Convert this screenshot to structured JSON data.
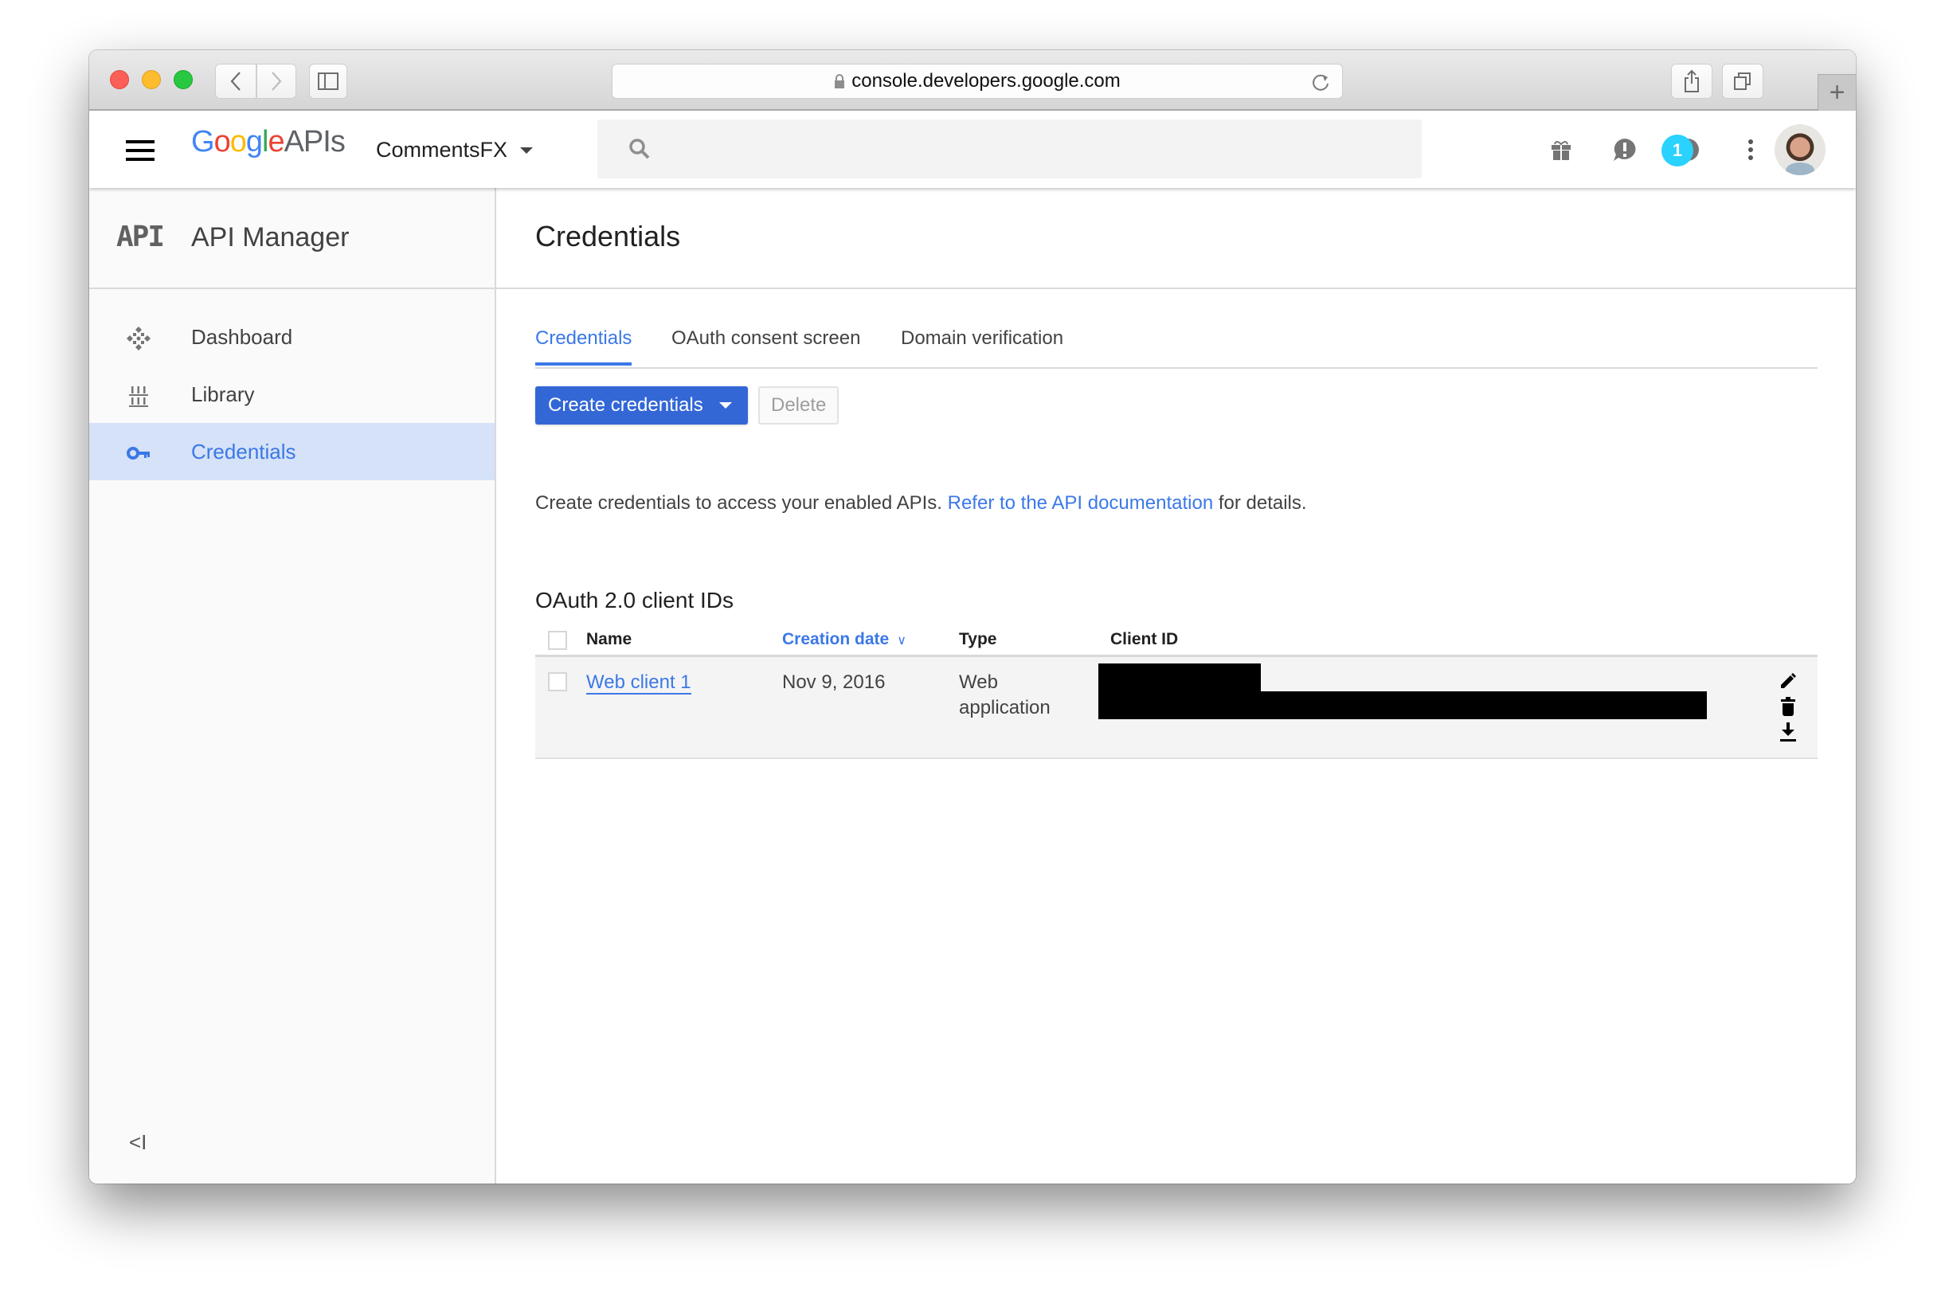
{
  "browser": {
    "url": "console.developers.google.com",
    "new_tab_label": "+"
  },
  "header": {
    "logo": {
      "google": [
        "G",
        "o",
        "o",
        "g",
        "l",
        "e"
      ],
      "suffix": "APIs"
    },
    "project": "CommentsFX",
    "search_placeholder": "",
    "notification_count": "1",
    "icons": [
      "gift-icon",
      "feedback-icon",
      "help-icon",
      "notifications-badge",
      "more-vert-icon",
      "avatar"
    ]
  },
  "sidebar": {
    "logo_text": "API",
    "title": "API Manager",
    "items": [
      {
        "label": "Dashboard",
        "icon": "dashboard-icon",
        "active": false
      },
      {
        "label": "Library",
        "icon": "library-icon",
        "active": false
      },
      {
        "label": "Credentials",
        "icon": "key-icon",
        "active": true
      }
    ],
    "collapse_label": "<I"
  },
  "page": {
    "title": "Credentials",
    "tabs": [
      {
        "label": "Credentials",
        "active": true
      },
      {
        "label": "OAuth consent screen",
        "active": false
      },
      {
        "label": "Domain verification",
        "active": false
      }
    ],
    "create_button": "Create credentials",
    "delete_button": "Delete",
    "description": {
      "before": "Create credentials to access your enabled APIs. ",
      "link": "Refer to the API documentation",
      "after": " for details."
    },
    "section_title": "OAuth 2.0 client IDs",
    "table": {
      "columns": {
        "name": "Name",
        "creation_date": "Creation date",
        "type": "Type",
        "client_id": "Client ID"
      },
      "sort_indicator": "∨",
      "rows": [
        {
          "name": "Web client 1",
          "creation_date": "Nov 9, 2016",
          "type_line1": "Web",
          "type_line2": "application",
          "client_id": "[redacted]"
        }
      ],
      "row_actions": [
        "edit-icon",
        "delete-icon",
        "download-icon"
      ]
    }
  },
  "colors": {
    "accent": "#3b78e7",
    "primary_button": "#3367d6",
    "active_nav_bg": "#d5e2f7",
    "notification_badge": "#29d2ff"
  }
}
